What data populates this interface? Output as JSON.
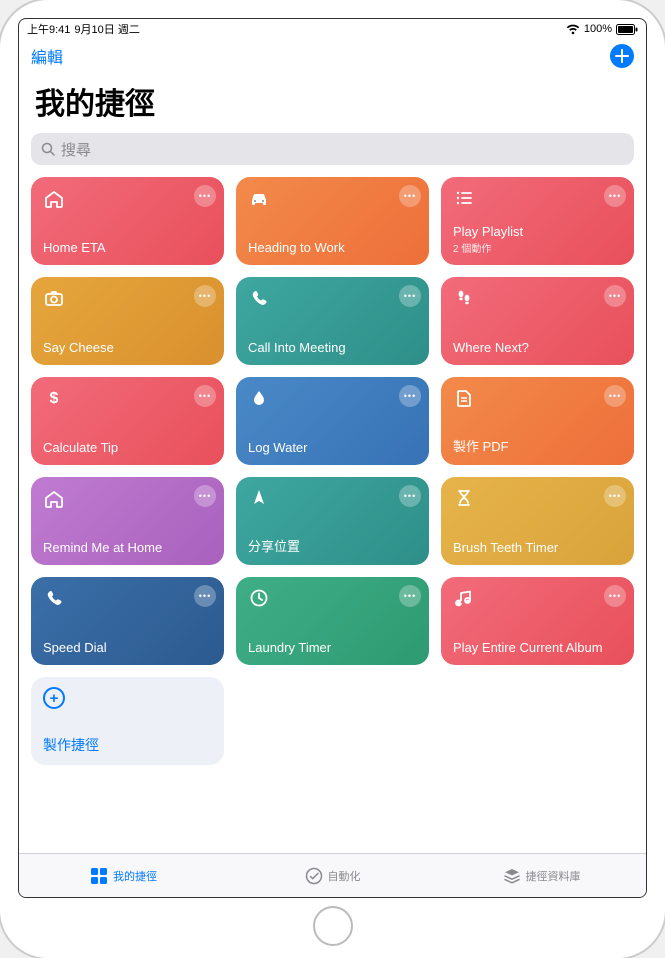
{
  "status": {
    "time": "上午9:41",
    "date": "9月10日 週二",
    "battery_pct": "100%"
  },
  "nav": {
    "edit_label": "編輯"
  },
  "header": {
    "title": "我的捷徑",
    "search_placeholder": "搜尋"
  },
  "shortcuts": [
    {
      "label": "Home ETA",
      "sublabel": "",
      "icon": "home",
      "color": "c-red"
    },
    {
      "label": "Heading to Work",
      "sublabel": "",
      "icon": "car",
      "color": "c-orange"
    },
    {
      "label": "Play Playlist",
      "sublabel": "2 個動作",
      "icon": "list",
      "color": "c-red"
    },
    {
      "label": "Say Cheese",
      "sublabel": "",
      "icon": "camera",
      "color": "c-gold"
    },
    {
      "label": "Call Into Meeting",
      "sublabel": "",
      "icon": "phone",
      "color": "c-teal"
    },
    {
      "label": "Where Next?",
      "sublabel": "",
      "icon": "footsteps",
      "color": "c-red"
    },
    {
      "label": "Calculate Tip",
      "sublabel": "",
      "icon": "dollar",
      "color": "c-red"
    },
    {
      "label": "Log Water",
      "sublabel": "",
      "icon": "water",
      "color": "c-blue"
    },
    {
      "label": "製作 PDF",
      "sublabel": "",
      "icon": "document",
      "color": "c-orange"
    },
    {
      "label": "Remind Me at Home",
      "sublabel": "",
      "icon": "home",
      "color": "c-purple"
    },
    {
      "label": "分享位置",
      "sublabel": "",
      "icon": "location",
      "color": "c-teal"
    },
    {
      "label": "Brush Teeth Timer",
      "sublabel": "",
      "icon": "hourglass",
      "color": "c-yellow"
    },
    {
      "label": "Speed Dial",
      "sublabel": "",
      "icon": "phone",
      "color": "c-navy"
    },
    {
      "label": "Laundry Timer",
      "sublabel": "",
      "icon": "clock",
      "color": "c-green"
    },
    {
      "label": "Play Entire Current Album",
      "sublabel": "",
      "icon": "music",
      "color": "c-red"
    }
  ],
  "create_shortcut_label": "製作捷徑",
  "tabs": {
    "my_shortcuts": "我的捷徑",
    "automation": "自動化",
    "gallery": "捷徑資料庫"
  }
}
